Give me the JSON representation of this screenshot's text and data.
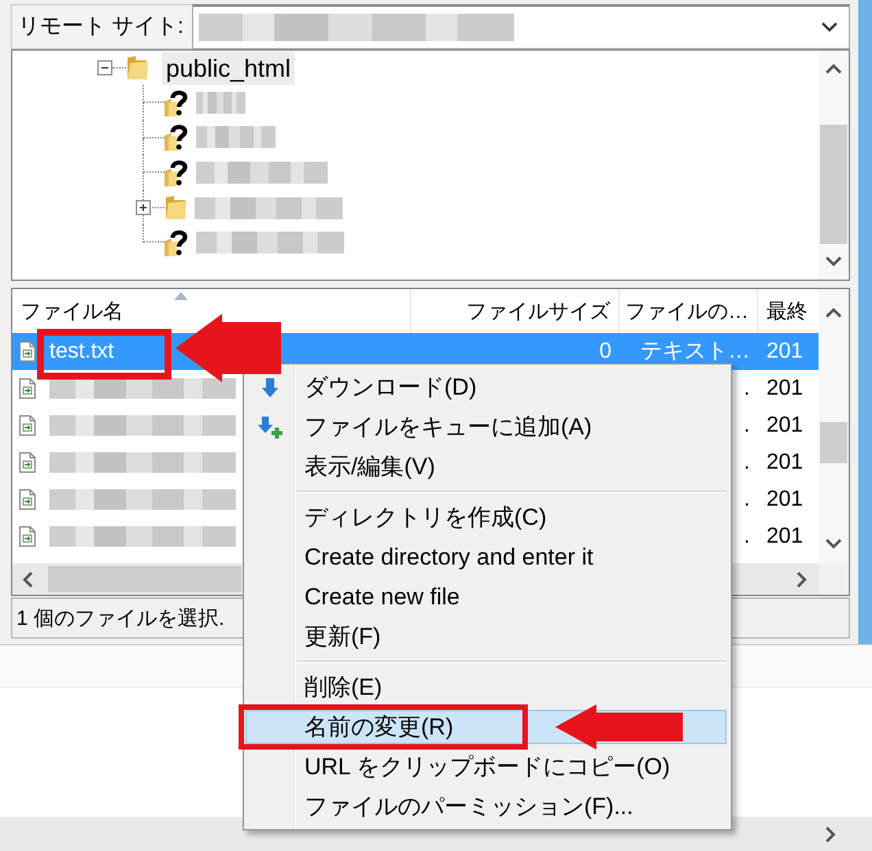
{
  "remote_site": {
    "label": "リモート サイト:"
  },
  "tree": {
    "nodes": [
      {
        "kind": "folder",
        "label": "public_html",
        "expanded": true,
        "selected": true,
        "children": [
          {
            "kind": "unknown",
            "selected": false
          },
          {
            "kind": "unknown",
            "selected": false
          },
          {
            "kind": "unknown",
            "selected": false
          },
          {
            "kind": "folder",
            "expanded": false,
            "selected": false
          },
          {
            "kind": "unknown",
            "selected": false
          }
        ]
      }
    ]
  },
  "file_list": {
    "columns": [
      {
        "label": "ファイル名",
        "sorted": true
      },
      {
        "label": "ファイルサイズ",
        "sorted": false
      },
      {
        "label": "ファイルの…",
        "sorted": false
      },
      {
        "label": "最終",
        "sorted": false
      }
    ],
    "rows": [
      {
        "name": "test.txt",
        "size": "0",
        "type": "テキスト…",
        "modified": "201",
        "selected": true
      },
      {
        "type": ".",
        "modified": "201",
        "selected": false
      },
      {
        "type": ".",
        "modified": "201",
        "selected": false
      },
      {
        "type": ".",
        "modified": "201",
        "selected": false
      },
      {
        "type": ".",
        "modified": "201",
        "selected": false
      },
      {
        "type": ".",
        "modified": "201",
        "selected": false
      }
    ]
  },
  "status_bar": {
    "text": "1 個のファイルを選択."
  },
  "context_menu": {
    "items": [
      {
        "kind": "download",
        "label": "ダウンロード(D)",
        "selected": false
      },
      {
        "kind": "enqueue",
        "label": "ファイルをキューに追加(A)",
        "selected": false
      },
      {
        "kind": "text",
        "label": "表示/編集(V)",
        "selected": false
      },
      {
        "kind": "separator"
      },
      {
        "kind": "text",
        "label": "ディレクトリを作成(C)",
        "selected": false
      },
      {
        "kind": "text",
        "label": "Create directory and enter it",
        "selected": false
      },
      {
        "kind": "text",
        "label": "Create new file",
        "selected": false
      },
      {
        "kind": "text",
        "label": "更新(F)",
        "selected": false
      },
      {
        "kind": "separator"
      },
      {
        "kind": "text",
        "label": "削除(E)",
        "selected": false
      },
      {
        "kind": "text",
        "label": "名前の変更(R)",
        "selected": true
      },
      {
        "kind": "text",
        "label": "URL をクリップボードにコピー(O)",
        "selected": false
      },
      {
        "kind": "text",
        "label": "ファイルのパーミッション(F)...",
        "selected": false
      }
    ]
  }
}
